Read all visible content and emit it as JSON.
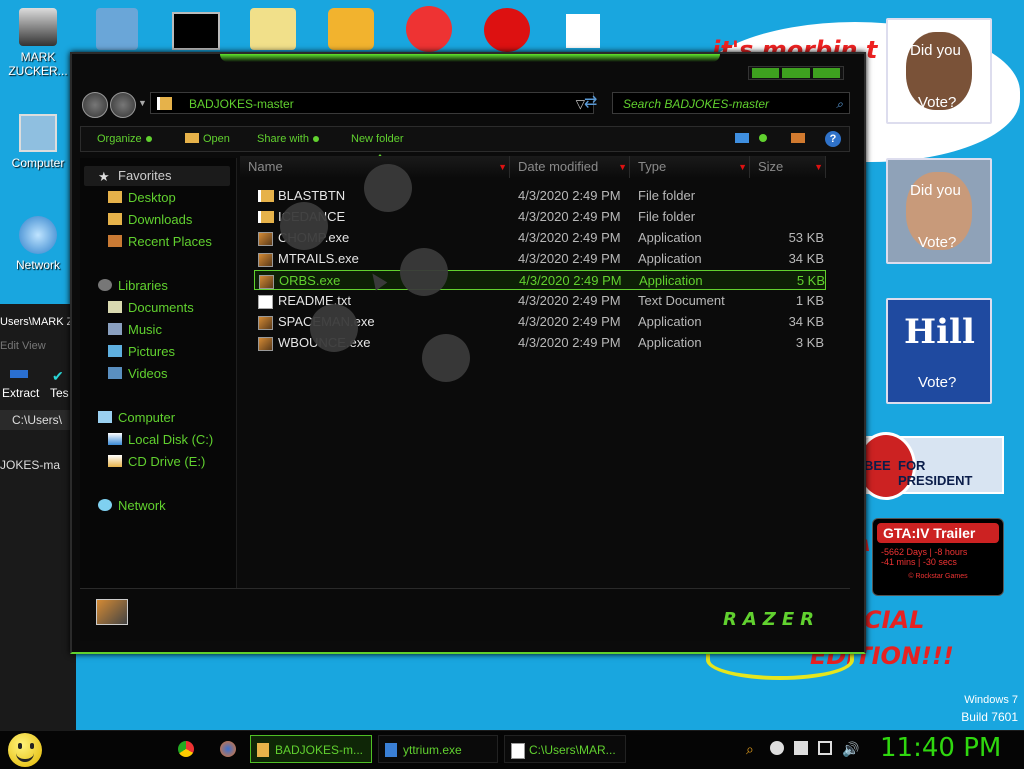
{
  "wallpaper": {
    "bubble_text": "it's morbin t",
    "edition_text_1": "CIAL",
    "edition_text_2": "EDITION!!!",
    "red_side_text": "A",
    "vote_cards": [
      {
        "line1": "Did you",
        "line2": "Vote?"
      },
      {
        "line1": "Did you",
        "line2": "Vote?"
      },
      {
        "line1": "Hill",
        "line2": "Vote?"
      }
    ],
    "huckabee": {
      "left": "BEE",
      "right": "FOR PRESIDENT"
    },
    "gta": {
      "title": "GTA:IV Trailer",
      "line1": "-5662 Days | -8 hours",
      "line2": "-41 mins | -30 secs",
      "footer": "© Rockstar Games"
    },
    "windows_version": "Windows 7",
    "build": "Build 7601"
  },
  "desktop_icons": [
    {
      "label": "MARK ZUCKER..."
    },
    {
      "label": "Computer"
    },
    {
      "label": "Network"
    }
  ],
  "background_window": {
    "path_text": "Users\\MARK Z",
    "menu": "Edit   View",
    "extract": "Extract",
    "test": "Tes",
    "address": "C:\\Users\\",
    "folder": "JOKES-ma"
  },
  "explorer": {
    "address": "BADJOKES-master",
    "search_placeholder": "Search BADJOKES-master",
    "toolbar": {
      "organize": "Organize",
      "open": "Open",
      "share_with": "Share with",
      "new_folder": "New folder"
    },
    "nav": {
      "favorites": "Favorites",
      "desktop": "Desktop",
      "downloads": "Downloads",
      "recent_places": "Recent Places",
      "libraries": "Libraries",
      "documents": "Documents",
      "music": "Music",
      "pictures": "Pictures",
      "videos": "Videos",
      "computer": "Computer",
      "local_disk": "Local Disk (C:)",
      "cd_drive": "CD Drive (E:)",
      "network": "Network"
    },
    "columns": {
      "name": "Name",
      "date": "Date modified",
      "type": "Type",
      "size": "Size"
    },
    "files": [
      {
        "name": "BLASTBTN",
        "date": "4/3/2020 2:49 PM",
        "type": "File folder",
        "size": "",
        "icon": "folder"
      },
      {
        "name": "ICEDANCE",
        "date": "4/3/2020 2:49 PM",
        "type": "File folder",
        "size": "",
        "icon": "folder"
      },
      {
        "name": "CHOMP.exe",
        "date": "4/3/2020 2:49 PM",
        "type": "Application",
        "size": "53 KB",
        "icon": "app"
      },
      {
        "name": "MTRAILS.exe",
        "date": "4/3/2020 2:49 PM",
        "type": "Application",
        "size": "34 KB",
        "icon": "app"
      },
      {
        "name": "ORBS.exe",
        "date": "4/3/2020 2:49 PM",
        "type": "Application",
        "size": "5 KB",
        "icon": "app",
        "selected": true
      },
      {
        "name": "README.txt",
        "date": "4/3/2020 2:49 PM",
        "type": "Text Document",
        "size": "1 KB",
        "icon": "txt"
      },
      {
        "name": "SPACEMAN.exe",
        "date": "4/3/2020 2:49 PM",
        "type": "Application",
        "size": "34 KB",
        "icon": "app"
      },
      {
        "name": "WBOUNCE.exe",
        "date": "4/3/2020 2:49 PM",
        "type": "Application",
        "size": "3 KB",
        "icon": "app"
      }
    ],
    "brand": "RAZER"
  },
  "taskbar": {
    "tasks": [
      {
        "label": "BADJOKES-m..."
      },
      {
        "label": "yttrium.exe"
      },
      {
        "label": "C:\\Users\\MAR..."
      }
    ],
    "clock": "11:40 PM"
  },
  "colors": {
    "accent": "#61d12f",
    "desktop": "#19a6df"
  }
}
